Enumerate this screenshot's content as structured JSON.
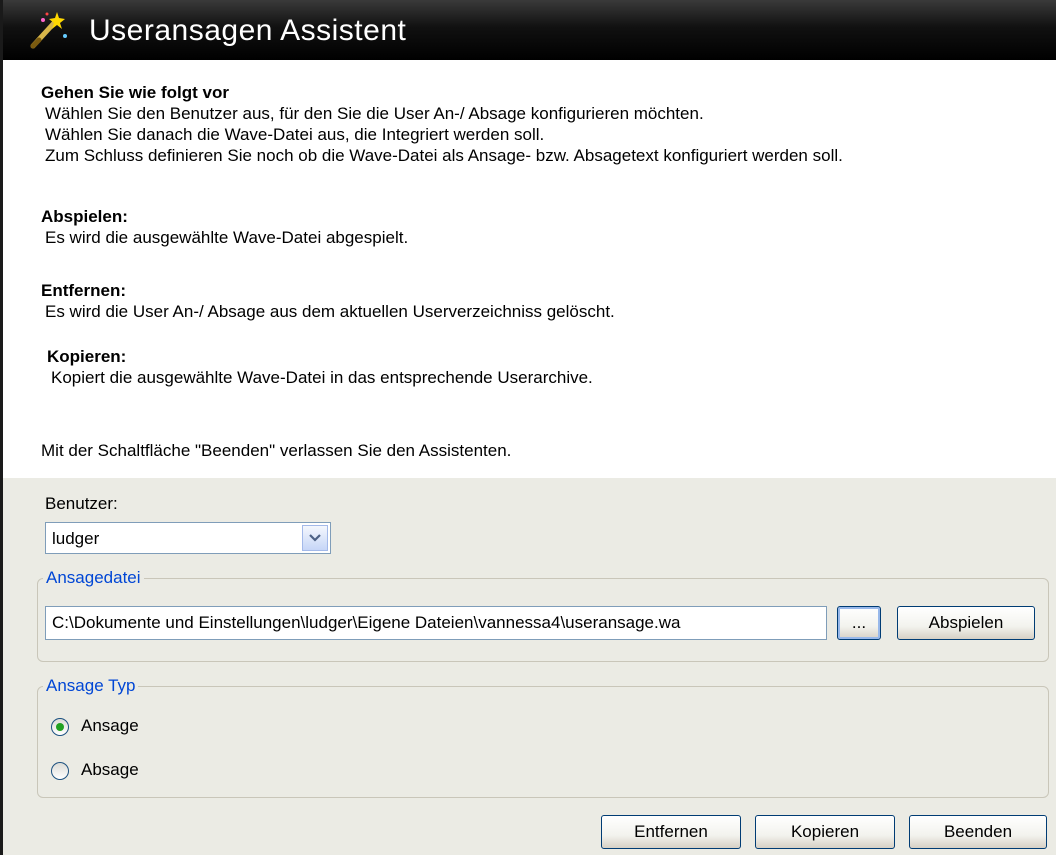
{
  "window": {
    "title": "Useransagen Assistent",
    "icon": "magic-wand-icon"
  },
  "help": {
    "heading": "Gehen Sie wie folgt vor",
    "lines": [
      "Wählen Sie den Benutzer aus, für den Sie die User An-/ Absage konfigurieren möchten.",
      "Wählen Sie danach die Wave-Datei aus, die Integriert werden soll.",
      "Zum Schluss definieren Sie noch ob die Wave-Datei als Ansage- bzw. Absagetext konfiguriert werden soll."
    ],
    "abspielen_heading": "Abspielen:",
    "abspielen_text": "Es wird die ausgewählte Wave-Datei abgespielt.",
    "entfernen_heading": "Entfernen:",
    "entfernen_text": "Es wird die User An-/ Absage aus dem aktuellen Userverzeichniss gelöscht.",
    "kopieren_heading": "Kopieren:",
    "kopieren_text": "Kopiert die ausgewählte Wave-Datei in das entsprechende Userarchive.",
    "footer": "Mit der Schaltfläche \"Beenden\" verlassen Sie den Assistenten."
  },
  "form": {
    "user_label": "Benutzer:",
    "user_value": "ludger",
    "file_group": "Ansagedatei",
    "file_path": "C:\\Dokumente und Einstellungen\\ludger\\Eigene Dateien\\vannessa4\\useransage.wa",
    "browse_label": "...",
    "play_label": "Abspielen",
    "type_group": "Ansage Typ",
    "radio_ansage": "Ansage",
    "radio_absage": "Absage",
    "selected_type": "Ansage"
  },
  "buttons": {
    "remove": "Entfernen",
    "copy": "Kopieren",
    "quit": "Beenden"
  },
  "colors": {
    "titlebar": "#000000",
    "panel": "#ebebe4",
    "group_title": "#0046d5",
    "radio_selected": "#21a121"
  }
}
